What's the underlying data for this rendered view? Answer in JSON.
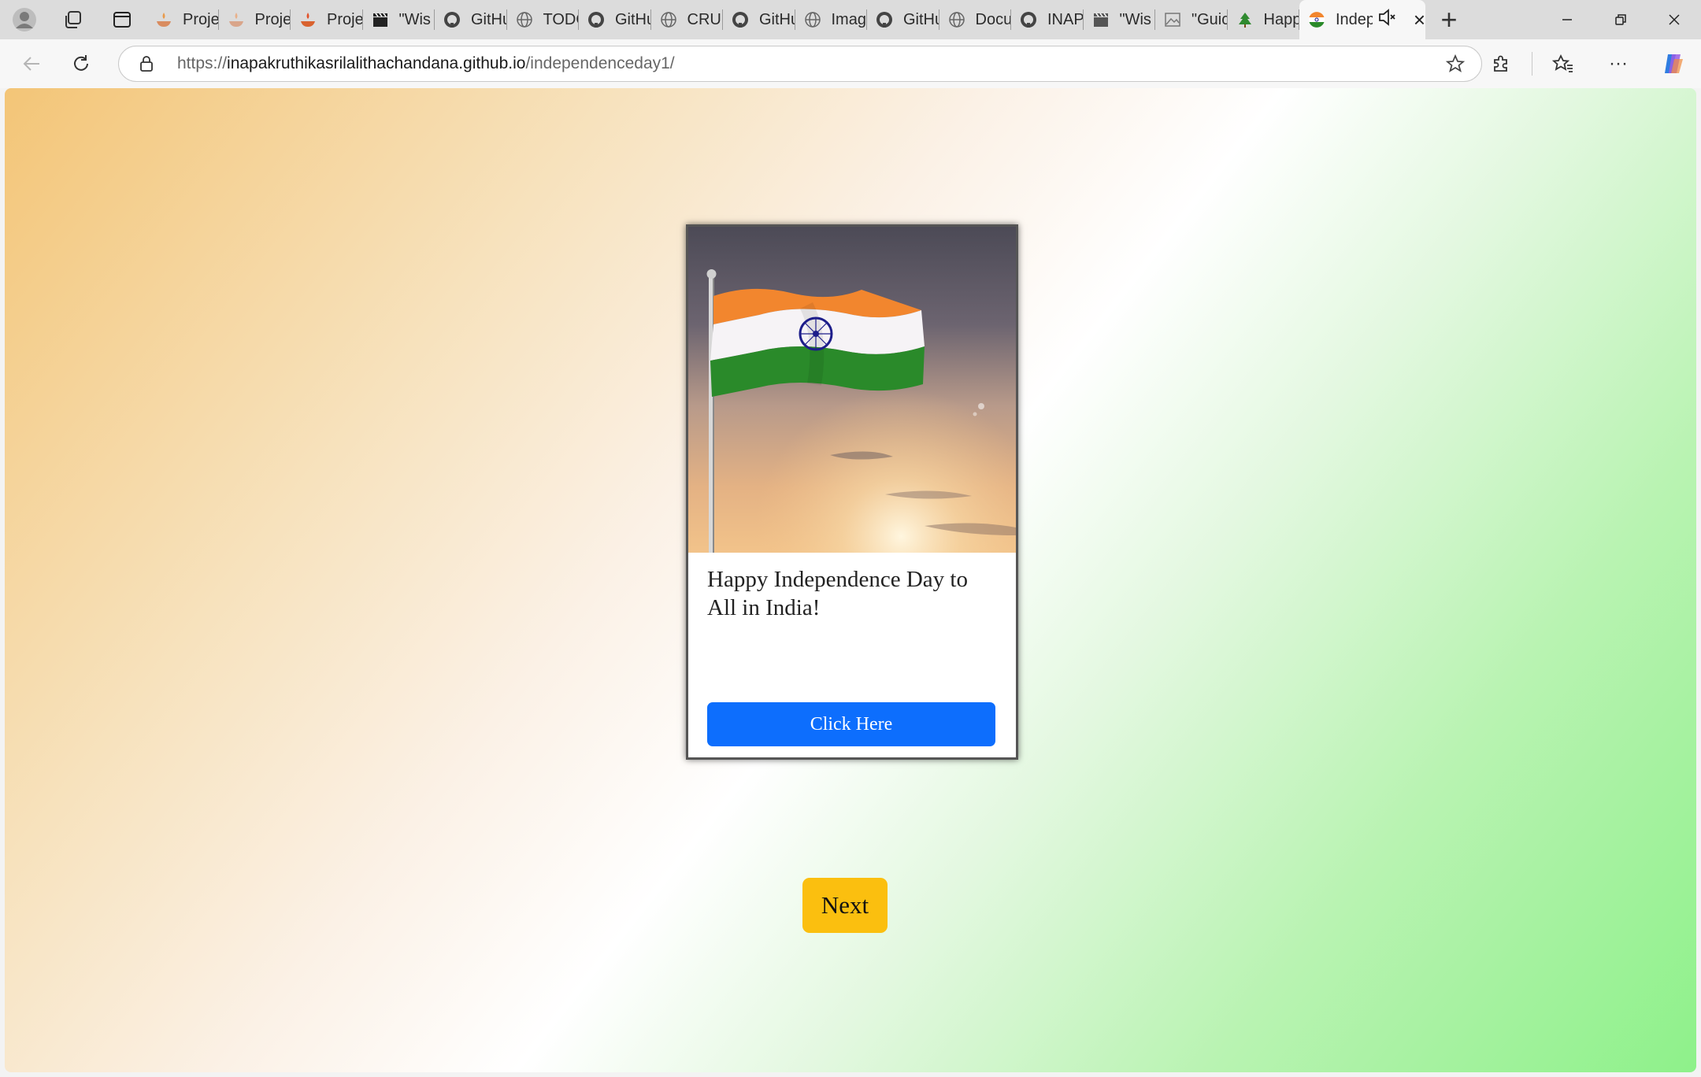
{
  "browser": {
    "tabs": [
      {
        "title": "Proje",
        "icon": "diya-icon"
      },
      {
        "title": "Proje",
        "icon": "diya-icon"
      },
      {
        "title": "Proje",
        "icon": "diya-icon"
      },
      {
        "title": "\"Wis",
        "icon": "clapper-icon"
      },
      {
        "title": "GitHu",
        "icon": "github-icon"
      },
      {
        "title": "TODO",
        "icon": "globe-icon"
      },
      {
        "title": "GitHu",
        "icon": "github-icon"
      },
      {
        "title": "CRUD",
        "icon": "globe-icon"
      },
      {
        "title": "GitHu",
        "icon": "github-icon"
      },
      {
        "title": "Imag",
        "icon": "globe-icon"
      },
      {
        "title": "GitHu",
        "icon": "github-icon"
      },
      {
        "title": "Docu",
        "icon": "globe-icon"
      },
      {
        "title": "INAP",
        "icon": "github-icon"
      },
      {
        "title": "\"Wis",
        "icon": "clapper-icon"
      },
      {
        "title": "\"Guic",
        "icon": "image-icon"
      },
      {
        "title": "Happ",
        "icon": "tree-icon"
      }
    ],
    "active_tab": {
      "title": "Indep",
      "icon": "india-flag-icon"
    },
    "address": {
      "scheme": "https://",
      "host": "inapakruthikasrilalithachandana.github.io",
      "path": "/independenceday1/"
    }
  },
  "page": {
    "card": {
      "message": "Happy Independence Day to All in India!",
      "button_label": "Click Here"
    },
    "next_label": "Next"
  },
  "colors": {
    "primary_button": "#0d6efd",
    "next_button": "#fbbf0f",
    "saffron": "#f2862e",
    "green": "#2a8a2a",
    "chakra": "#1d1d8a"
  }
}
